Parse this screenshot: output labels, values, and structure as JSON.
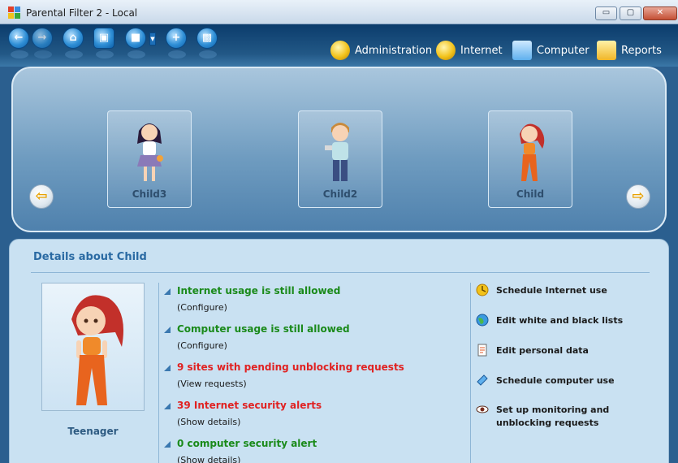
{
  "window": {
    "title": "Parental Filter 2 - Local",
    "minimize_glyph": "▭",
    "maximize_glyph": "▢",
    "close_glyph": "✕"
  },
  "toolbar": {
    "icons": [
      "back-icon",
      "forward-icon",
      "home-icon",
      "image-icon",
      "save-dropdown-icon",
      "user-add-icon",
      "disk-icon"
    ],
    "nav": [
      {
        "label": "Administration",
        "icon": "administration-icon"
      },
      {
        "label": "Internet",
        "icon": "internet-icon"
      },
      {
        "label": "Computer",
        "icon": "computer-icon"
      },
      {
        "label": "Reports",
        "icon": "reports-icon"
      }
    ]
  },
  "children": {
    "prev_glyph": "⇦",
    "next_glyph": "⇨",
    "items": [
      {
        "name": "Child3"
      },
      {
        "name": "Child2"
      },
      {
        "name": "Child"
      }
    ]
  },
  "details": {
    "title": "Details about Child",
    "age_group": "Teenager",
    "status": [
      {
        "text": "Internet usage is still allowed",
        "link": "(Configure)",
        "type": "ok"
      },
      {
        "text": "Computer usage is still allowed",
        "link": "(Configure)",
        "type": "ok"
      },
      {
        "text": "9 sites with pending unblocking requests",
        "link": "(View requests)",
        "type": "warn"
      },
      {
        "text": "39 Internet security alerts",
        "link": "(Show details)",
        "type": "warn"
      },
      {
        "text": "0 computer security alert",
        "link": "(Show details)",
        "type": "ok"
      }
    ],
    "actions": [
      {
        "label": "Schedule Internet use",
        "icon": "schedule-internet-icon"
      },
      {
        "label": "Edit white and black lists",
        "icon": "globe-icon"
      },
      {
        "label": "Edit personal data",
        "icon": "document-icon"
      },
      {
        "label": "Schedule computer use",
        "icon": "schedule-computer-icon"
      },
      {
        "label": "Set up monitoring and unblocking requests",
        "icon": "eye-icon"
      }
    ]
  },
  "colors": {
    "ok": "#1a8a1a",
    "warn": "#e02222",
    "accent": "#2a6aa3"
  }
}
